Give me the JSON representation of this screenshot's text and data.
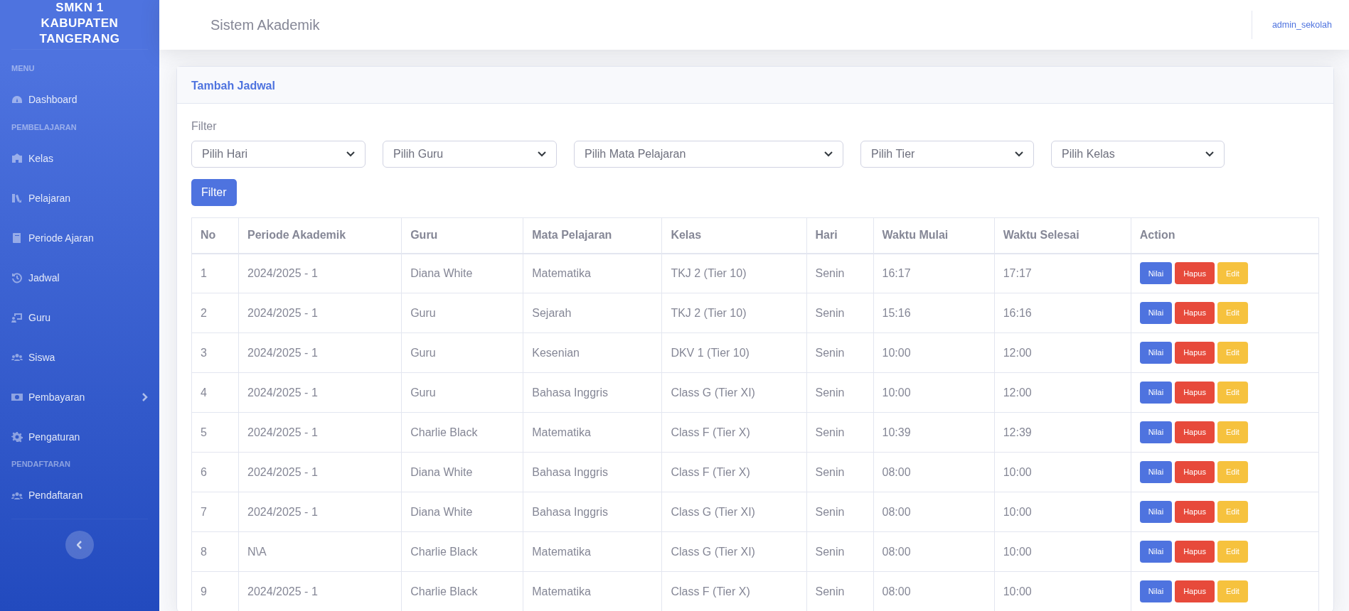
{
  "sidebar": {
    "brand": "SMKN 1 KABUPATEN TANGERANG",
    "items": [
      {
        "kind": "heading",
        "label": "MENU"
      },
      {
        "kind": "link",
        "label": "Dashboard",
        "expandable": false
      },
      {
        "kind": "heading",
        "label": "PEMBELAJARAN"
      },
      {
        "kind": "link",
        "label": "Kelas",
        "expandable": false
      },
      {
        "kind": "link",
        "label": "Pelajaran",
        "expandable": false
      },
      {
        "kind": "link",
        "label": "Periode Ajaran",
        "expandable": false
      },
      {
        "kind": "link",
        "label": "Jadwal",
        "expandable": false
      },
      {
        "kind": "link",
        "label": "Guru",
        "expandable": false
      },
      {
        "kind": "link",
        "label": "Siswa",
        "expandable": false
      },
      {
        "kind": "link",
        "label": "Pembayaran",
        "expandable": true
      },
      {
        "kind": "link",
        "label": "Pengaturan",
        "expandable": false
      },
      {
        "kind": "heading",
        "label": "PENDAFTARAN"
      },
      {
        "kind": "link",
        "label": "Pendaftaran",
        "expandable": false
      }
    ]
  },
  "topbar": {
    "title": "Sistem Akademik",
    "user": "admin_sekolah"
  },
  "card": {
    "title": "Tambah Jadwal",
    "filter_label": "Filter",
    "filters": [
      {
        "placeholder": "Pilih Hari"
      },
      {
        "placeholder": "Pilih Guru"
      },
      {
        "placeholder": "Pilih Mata Pelajaran"
      },
      {
        "placeholder": "Pilih Tier"
      },
      {
        "placeholder": "Pilih Kelas"
      }
    ],
    "filter_button": "Filter",
    "table": {
      "columns": [
        "No",
        "Periode Akademik",
        "Guru",
        "Mata Pelajaran",
        "Kelas",
        "Hari",
        "Waktu Mulai",
        "Waktu Selesai",
        "Action"
      ],
      "rows": [
        {
          "cells": [
            "1",
            "2024/2025 - 1",
            "Diana White",
            "Matematika",
            "TKJ 2 (Tier 10)",
            "Senin",
            "16:17",
            "17:17"
          ],
          "actions": [
            "Nilai",
            "Hapus",
            "Edit"
          ]
        },
        {
          "cells": [
            "2",
            "2024/2025 - 1",
            "Guru",
            "Sejarah",
            "TKJ 2 (Tier 10)",
            "Senin",
            "15:16",
            "16:16"
          ],
          "actions": [
            "Nilai",
            "Hapus",
            "Edit"
          ]
        },
        {
          "cells": [
            "3",
            "2024/2025 - 1",
            "Guru",
            "Kesenian",
            "DKV 1 (Tier 10)",
            "Senin",
            "10:00",
            "12:00"
          ],
          "actions": [
            "Nilai",
            "Hapus",
            "Edit"
          ]
        },
        {
          "cells": [
            "4",
            "2024/2025 - 1",
            "Guru",
            "Bahasa Inggris",
            "Class G (Tier XI)",
            "Senin",
            "10:00",
            "12:00"
          ],
          "actions": [
            "Nilai",
            "Hapus",
            "Edit"
          ]
        },
        {
          "cells": [
            "5",
            "2024/2025 - 1",
            "Charlie Black",
            "Matematika",
            "Class F (Tier X)",
            "Senin",
            "10:39",
            "12:39"
          ],
          "actions": [
            "Nilai",
            "Hapus",
            "Edit"
          ]
        },
        {
          "cells": [
            "6",
            "2024/2025 - 1",
            "Diana White",
            "Bahasa Inggris",
            "Class F (Tier X)",
            "Senin",
            "08:00",
            "10:00"
          ],
          "actions": [
            "Nilai",
            "Hapus",
            "Edit"
          ]
        },
        {
          "cells": [
            "7",
            "2024/2025 - 1",
            "Diana White",
            "Bahasa Inggris",
            "Class G (Tier XI)",
            "Senin",
            "08:00",
            "10:00"
          ],
          "actions": [
            "Nilai",
            "Hapus",
            "Edit"
          ]
        },
        {
          "cells": [
            "8",
            "N\\A",
            "Charlie Black",
            "Matematika",
            "Class G (Tier XI)",
            "Senin",
            "08:00",
            "10:00"
          ],
          "actions": [
            "Nilai",
            "Hapus",
            "Edit"
          ]
        },
        {
          "cells": [
            "9",
            "2024/2025 - 1",
            "Charlie Black",
            "Matematika",
            "Class F (Tier X)",
            "Senin",
            "08:00",
            "10:00"
          ],
          "actions": [
            "Nilai",
            "Hapus",
            "Edit"
          ]
        }
      ]
    }
  }
}
